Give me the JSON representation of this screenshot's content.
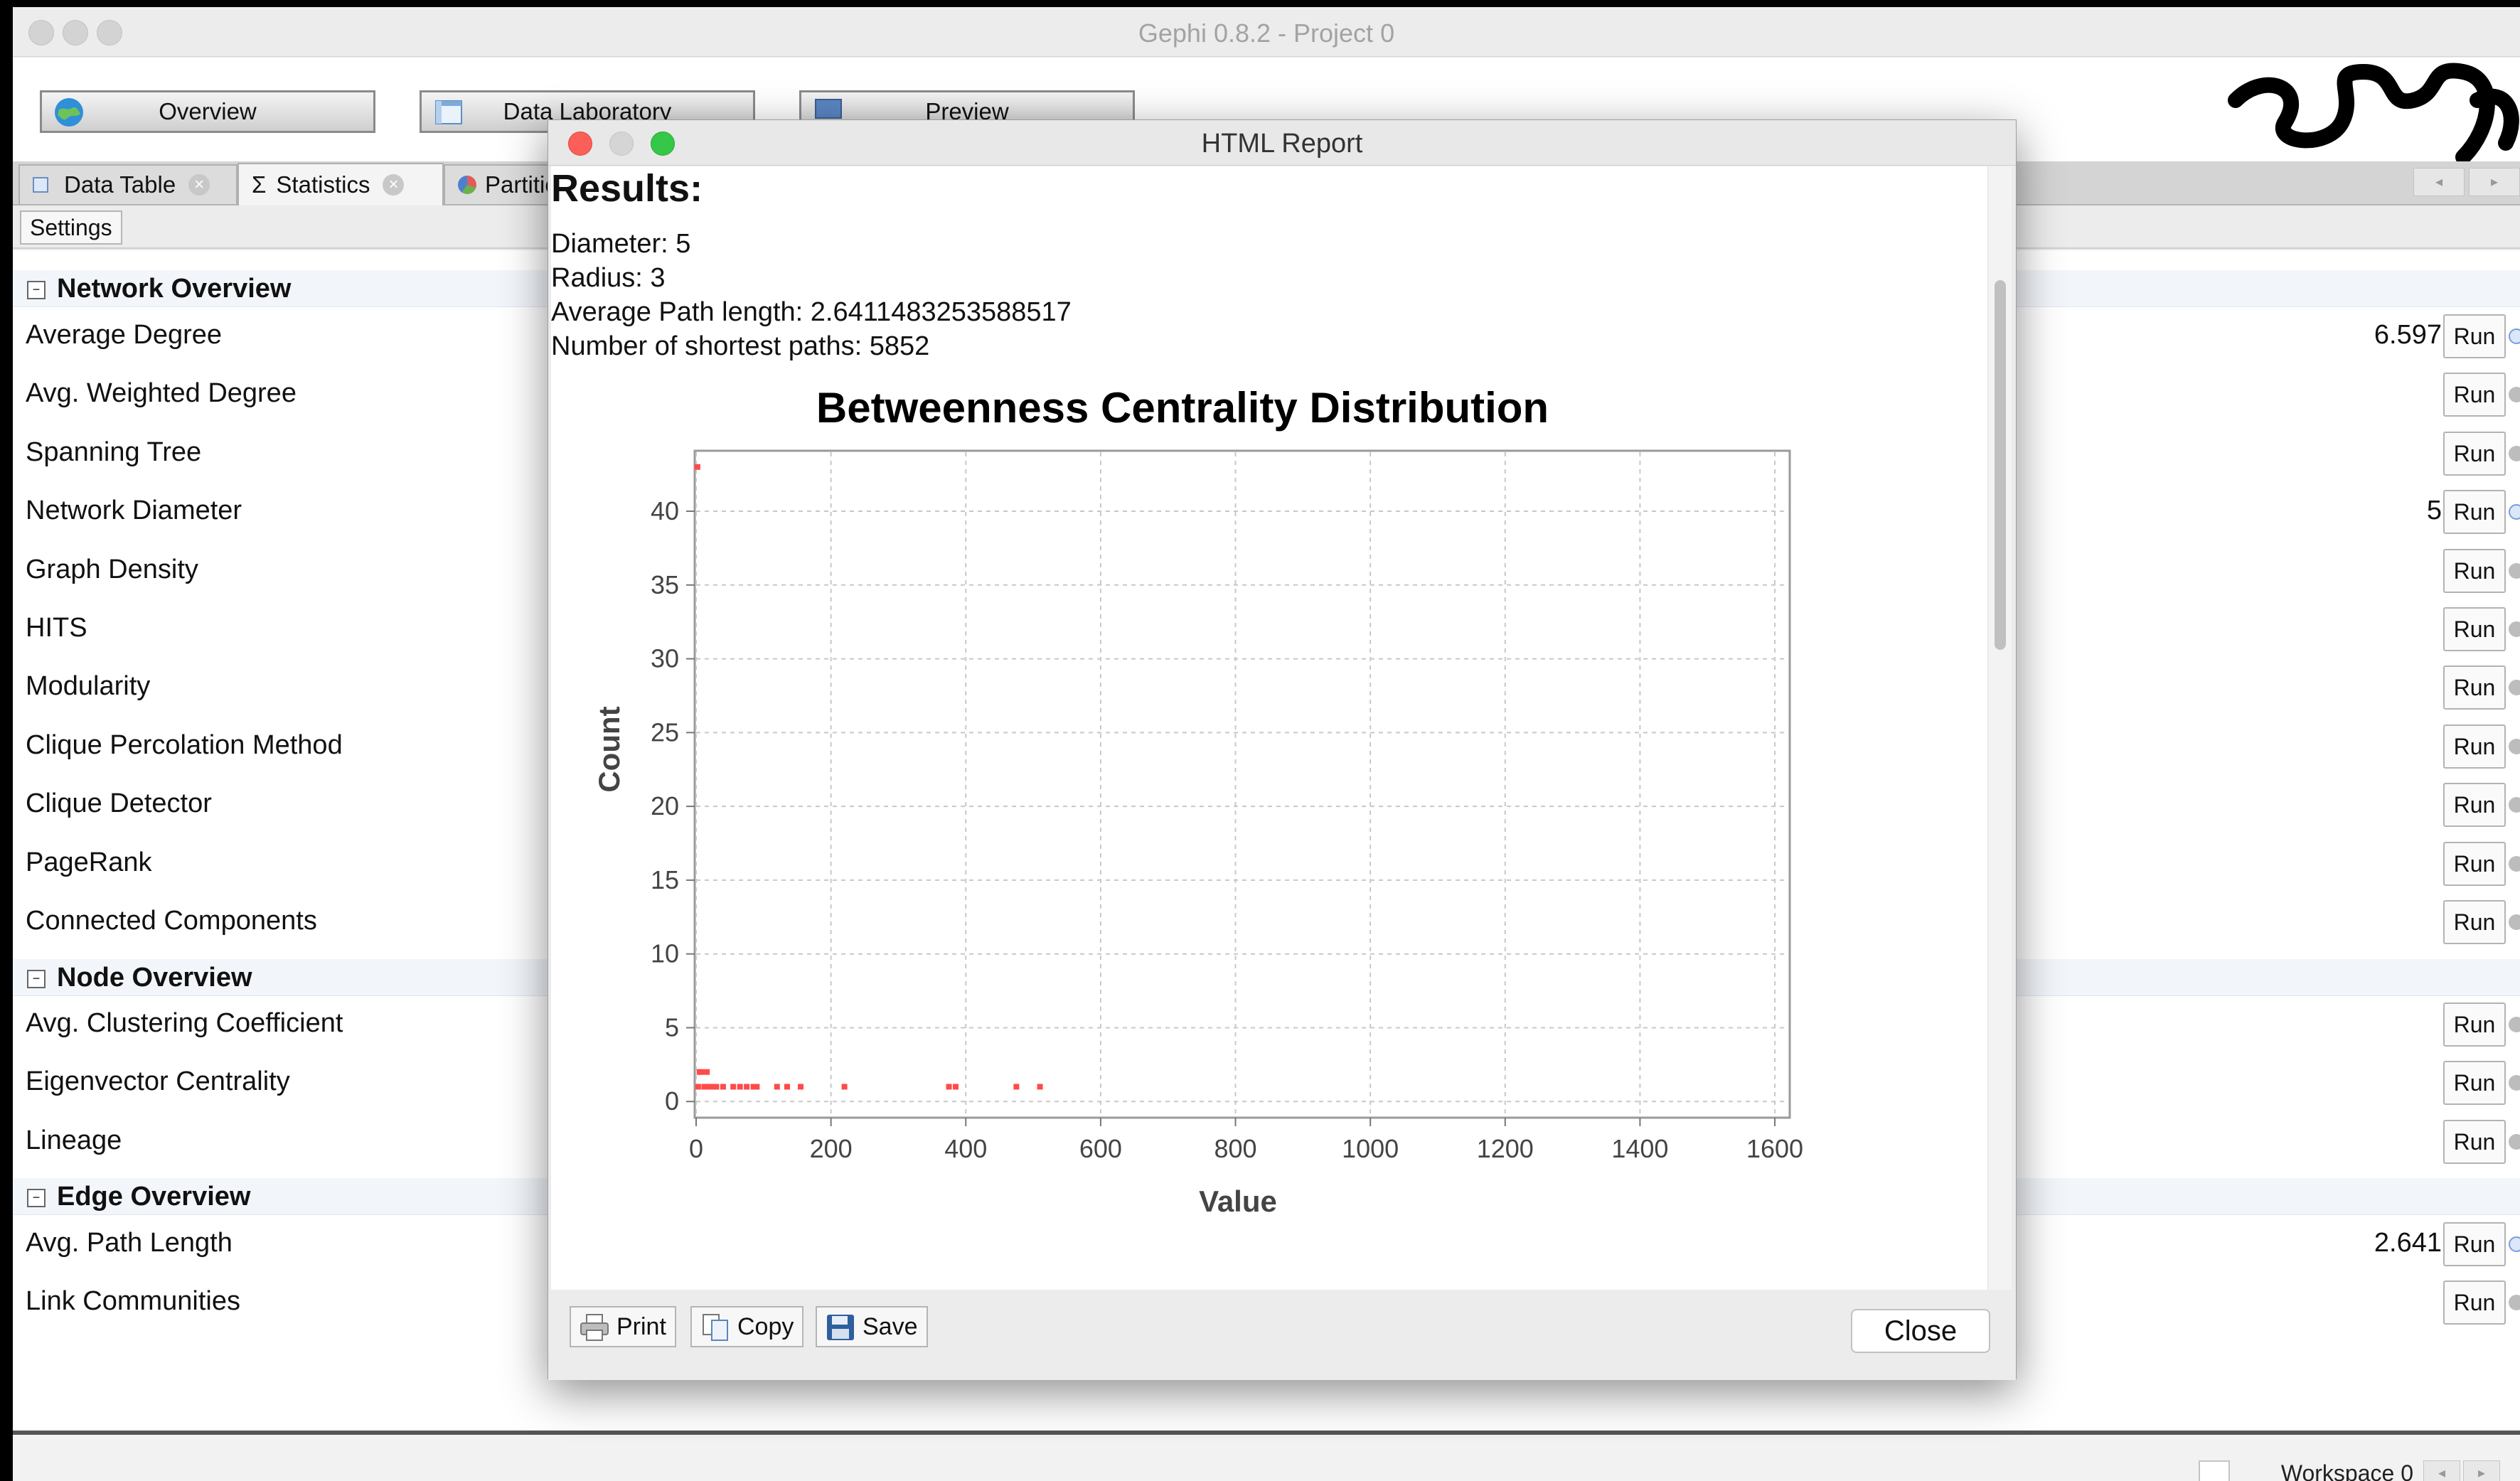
{
  "window": {
    "title": "Gephi 0.8.2 - Project 0"
  },
  "toolbar": {
    "overview": "Overview",
    "data_laboratory": "Data Laboratory",
    "preview": "Preview"
  },
  "tabs": {
    "data_table": "Data Table",
    "statistics": "Statistics",
    "partition": "Partitio"
  },
  "settings": "Settings",
  "sections": {
    "network": "Network Overview",
    "node": "Node Overview",
    "edge": "Edge Overview"
  },
  "network_rows": [
    {
      "name": "Average Degree",
      "value": "6.597"
    },
    {
      "name": "Avg. Weighted Degree",
      "value": ""
    },
    {
      "name": "Spanning Tree",
      "value": ""
    },
    {
      "name": "Network Diameter",
      "value": "5"
    },
    {
      "name": "Graph Density",
      "value": ""
    },
    {
      "name": "HITS",
      "value": ""
    },
    {
      "name": "Modularity",
      "value": ""
    },
    {
      "name": "Clique Percolation Method",
      "value": ""
    },
    {
      "name": "Clique Detector",
      "value": ""
    },
    {
      "name": "PageRank",
      "value": ""
    },
    {
      "name": "Connected Components",
      "value": ""
    }
  ],
  "node_rows": [
    {
      "name": "Avg. Clustering Coefficient",
      "value": ""
    },
    {
      "name": "Eigenvector Centrality",
      "value": ""
    },
    {
      "name": "Lineage",
      "value": ""
    }
  ],
  "edge_rows": [
    {
      "name": "Avg. Path Length",
      "value": "2.641"
    },
    {
      "name": "Link Communities",
      "value": ""
    }
  ],
  "run_label": "Run",
  "statusbar": {
    "workspace": "Workspace 0"
  },
  "dialog": {
    "title": "HTML Report",
    "results_heading": "Results:",
    "stats": [
      "Diameter: 5",
      "Radius: 3",
      "Average Path length: 2.6411483253588517",
      "Number of shortest paths: 5852"
    ],
    "buttons": {
      "print": "Print",
      "copy": "Copy",
      "save": "Save",
      "close": "Close"
    }
  },
  "chart_data": {
    "type": "scatter",
    "title": "Betweenness Centrality Distribution",
    "xlabel": "Value",
    "ylabel": "Count",
    "xlim": [
      0,
      1620
    ],
    "ylim": [
      -1,
      44
    ],
    "xticks": [
      0,
      200,
      400,
      600,
      800,
      1000,
      1200,
      1400,
      1600
    ],
    "yticks": [
      0,
      5,
      10,
      15,
      20,
      25,
      30,
      35,
      40
    ],
    "grid": true,
    "point_color": "#ff4a4a",
    "series": [
      {
        "points": [
          [
            2,
            43
          ],
          [
            3,
            1
          ],
          [
            5,
            2
          ],
          [
            8,
            2
          ],
          [
            12,
            1
          ],
          [
            16,
            2
          ],
          [
            20,
            1
          ],
          [
            25,
            1
          ],
          [
            30,
            1
          ],
          [
            40,
            1
          ],
          [
            55,
            1
          ],
          [
            65,
            1
          ],
          [
            75,
            1
          ],
          [
            85,
            1
          ],
          [
            90,
            1
          ],
          [
            120,
            1
          ],
          [
            135,
            1
          ],
          [
            155,
            1
          ],
          [
            220,
            1
          ],
          [
            375,
            1
          ],
          [
            385,
            1
          ],
          [
            475,
            1
          ],
          [
            510,
            1
          ]
        ]
      }
    ]
  }
}
